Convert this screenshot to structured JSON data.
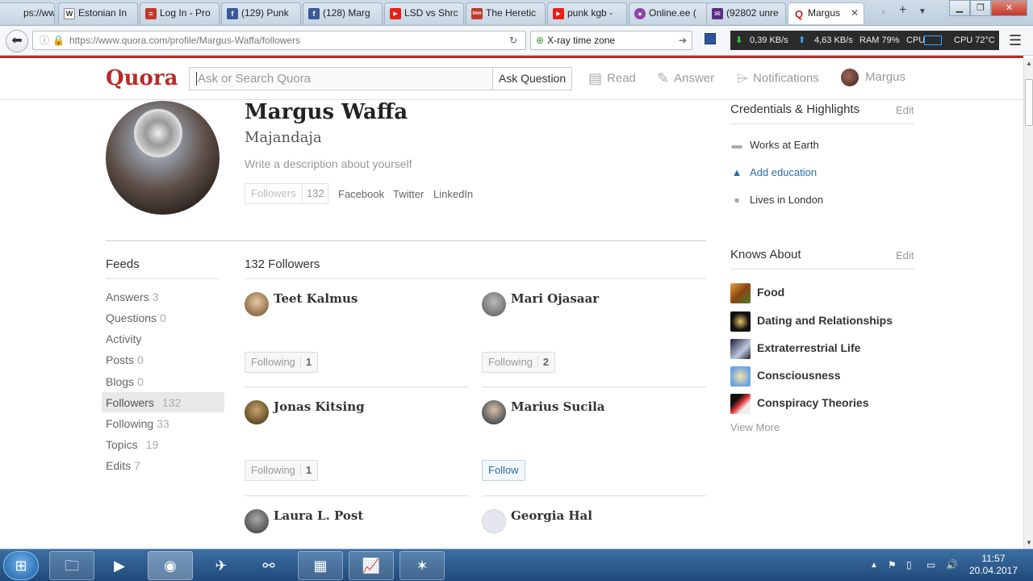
{
  "browser": {
    "tabs": [
      {
        "title": "ps://ww",
        "fav": "",
        "favcolor": "#c8d4e0"
      },
      {
        "title": "Estonian In",
        "fav": "W",
        "favcolor": "#333"
      },
      {
        "title": "Log In - Pro",
        "fav": "≡",
        "favcolor": "#c0392b"
      },
      {
        "title": "(129) Punk",
        "fav": "f",
        "favcolor": "#3b5998"
      },
      {
        "title": "(128) Marg",
        "fav": "f",
        "favcolor": "#3b5998"
      },
      {
        "title": "LSD vs Shrc",
        "fav": "▶",
        "favcolor": "#e62117"
      },
      {
        "title": "The Heretic",
        "fav": "tmn",
        "favcolor": "#c0392b"
      },
      {
        "title": "punk kgb -",
        "fav": "▶",
        "favcolor": "#e62117"
      },
      {
        "title": "Online.ee (",
        "fav": "●",
        "favcolor": "#8e44ad"
      },
      {
        "title": "(92802 unre",
        "fav": "✉",
        "favcolor": "#5b2c83"
      },
      {
        "title": "Margus",
        "fav": "Q",
        "favcolor": "#b92b27"
      }
    ],
    "url": "https://www.quora.com/profile/Margus-Waffa/followers",
    "url_host": "quora.com",
    "search_box": "X-ray time zone",
    "sysmon": {
      "down": "0,39 KB/s",
      "up": "4,63 KB/s",
      "ram": "RAM 79%",
      "cpu_label": "CPU",
      "cpu_temp": "CPU 72°C"
    }
  },
  "quora": {
    "logo": "Quora",
    "search_placeholder": "Ask or Search Quora",
    "ask_button": "Ask Question",
    "nav": {
      "read": "Read",
      "answer": "Answer",
      "notifications": "Notifications",
      "user": "Margus"
    }
  },
  "profile": {
    "name": "Margus Waffa",
    "tagline": "Majandaja",
    "description_prompt": "Write a description about yourself",
    "followers_label": "Followers",
    "followers_count": "132",
    "social": [
      "Facebook",
      "Twitter",
      "LinkedIn"
    ]
  },
  "feeds": {
    "heading": "Feeds",
    "items": [
      {
        "label": "Answers",
        "count": "3"
      },
      {
        "label": "Questions",
        "count": "0"
      },
      {
        "label": "Activity",
        "count": ""
      },
      {
        "label": "Posts",
        "count": "0"
      },
      {
        "label": "Blogs",
        "count": "0"
      },
      {
        "label": "Followers",
        "count": "132"
      },
      {
        "label": "Following",
        "count": "33"
      },
      {
        "label": "Topics",
        "count": "19"
      },
      {
        "label": "Edits",
        "count": "7"
      }
    ]
  },
  "followers": {
    "heading": "132 Followers",
    "people": [
      {
        "name": "Teet Kalmus",
        "button": "Following",
        "count": "1"
      },
      {
        "name": "Mari Ojasaar",
        "button": "Following",
        "count": "2"
      },
      {
        "name": "Jonas Kitsing",
        "button": "Following",
        "count": "1"
      },
      {
        "name": "Marius Sucila",
        "button": "Follow",
        "count": ""
      },
      {
        "name": "Laura L. Post",
        "button": "",
        "count": ""
      },
      {
        "name": "Georgia Hal",
        "button": "",
        "count": ""
      }
    ]
  },
  "credentials": {
    "heading": "Credentials & Highlights",
    "edit": "Edit",
    "items": [
      "Works at Earth",
      "Add education",
      "Lives in London"
    ]
  },
  "knows_about": {
    "heading": "Knows About",
    "edit": "Edit",
    "topics": [
      "Food",
      "Dating and Relationships",
      "Extraterrestrial Life",
      "Consciousness",
      "Conspiracy Theories"
    ],
    "view_more": "View More"
  },
  "taskbar": {
    "time": "11:57",
    "date": "20.04.2017"
  }
}
